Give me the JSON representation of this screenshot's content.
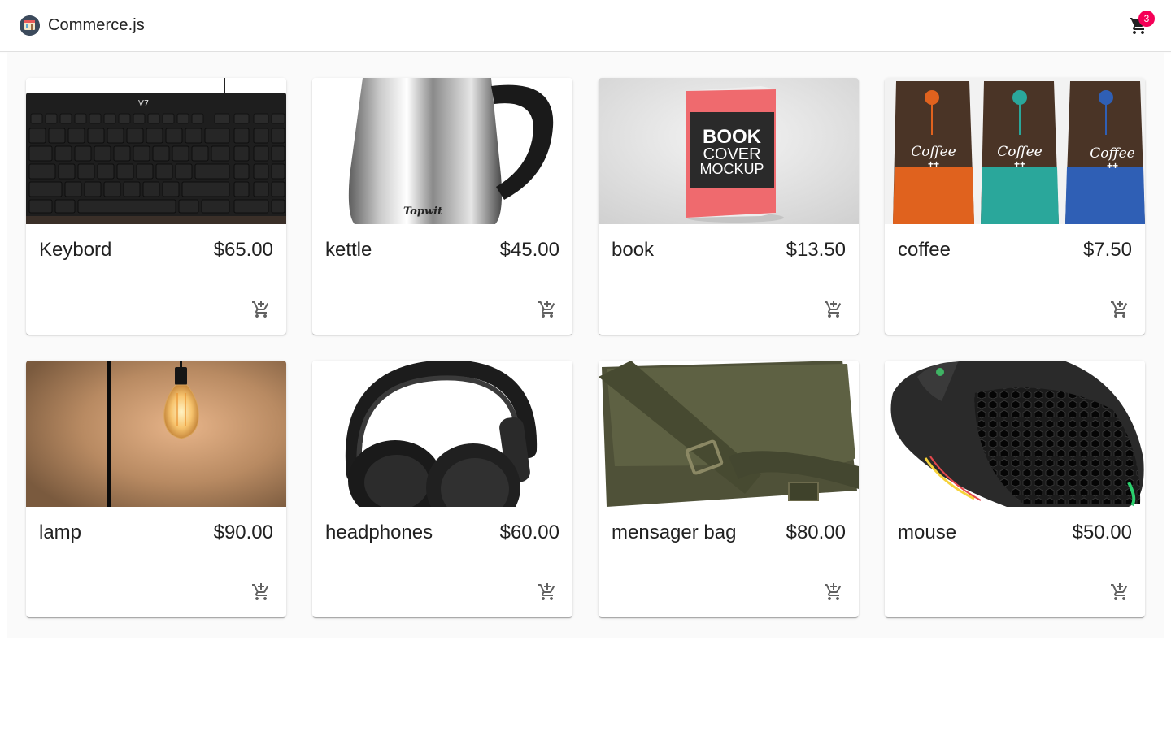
{
  "app": {
    "title": "Commerce.js"
  },
  "cart": {
    "count": "3",
    "icon": "shopping-cart-icon"
  },
  "products": [
    {
      "name": "Keybord",
      "price": "$65.00",
      "image": "keyboard"
    },
    {
      "name": "kettle",
      "price": "$45.00",
      "image": "kettle"
    },
    {
      "name": "book",
      "price": "$13.50",
      "image": "book"
    },
    {
      "name": "coffee",
      "price": "$7.50",
      "image": "coffee"
    },
    {
      "name": "lamp",
      "price": "$90.00",
      "image": "lamp"
    },
    {
      "name": "headphones",
      "price": "$60.00",
      "image": "headphones"
    },
    {
      "name": "mensager bag",
      "price": "$80.00",
      "image": "bag"
    },
    {
      "name": "mouse",
      "price": "$50.00",
      "image": "mouse"
    }
  ],
  "images": {
    "book": {
      "line1": "BOOK",
      "line2": "COVER",
      "line3": "MOCKUP"
    },
    "coffee": {
      "label": "Coffee",
      "sub": "++"
    },
    "kettle": {
      "brand": "Topwit"
    }
  },
  "colors": {
    "badge": "#f50057",
    "background": "#fafafa",
    "text": "#212121"
  }
}
